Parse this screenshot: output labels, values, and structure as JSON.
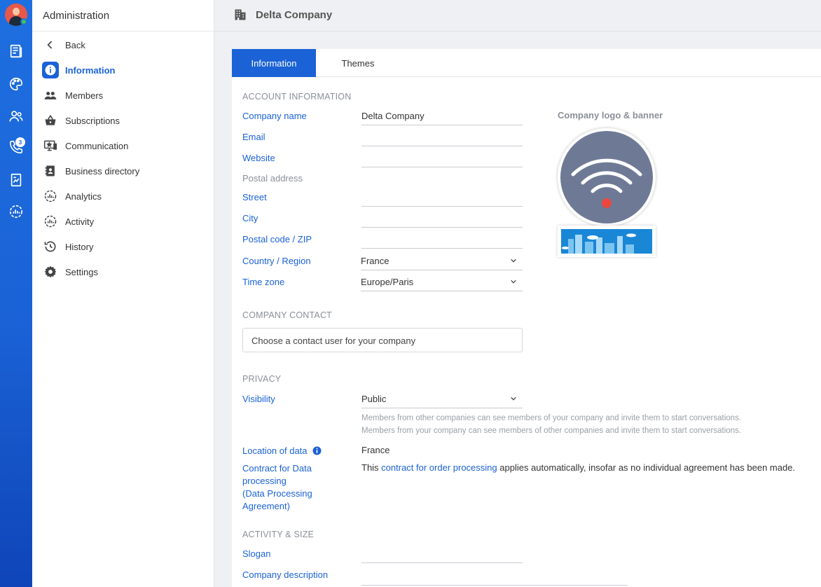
{
  "rail": {
    "badge_count": "3",
    "items": [
      "news-icon",
      "palette-icon",
      "contacts-icon",
      "phone-icon",
      "document-icon",
      "analytics-icon"
    ]
  },
  "sidebar": {
    "title": "Administration",
    "items": [
      {
        "label": "Back",
        "icon": "chevron-left-icon"
      },
      {
        "label": "Information",
        "icon": "info-icon",
        "active": true
      },
      {
        "label": "Members",
        "icon": "members-icon"
      },
      {
        "label": "Subscriptions",
        "icon": "basket-icon"
      },
      {
        "label": "Communication",
        "icon": "monitor-star-icon"
      },
      {
        "label": "Business directory",
        "icon": "address-book-icon"
      },
      {
        "label": "Analytics",
        "icon": "analytics-icon"
      },
      {
        "label": "Activity",
        "icon": "activity-icon"
      },
      {
        "label": "History",
        "icon": "history-icon"
      },
      {
        "label": "Settings",
        "icon": "gear-icon"
      }
    ]
  },
  "header": {
    "title": "Delta Company",
    "icon": "building-icon"
  },
  "tabs": [
    {
      "label": "Information",
      "active": true
    },
    {
      "label": "Themes",
      "active": false
    }
  ],
  "account": {
    "section": "ACCOUNT INFORMATION",
    "company_name_label": "Company name",
    "company_name_value": "Delta Company",
    "email_label": "Email",
    "email_value": "",
    "website_label": "Website",
    "website_value": "",
    "postal_address_label": "Postal address",
    "street_label": "Street",
    "street_value": "",
    "city_label": "City",
    "city_value": "",
    "zip_label": "Postal code / ZIP",
    "zip_value": "",
    "country_label": "Country / Region",
    "country_value": "France",
    "timezone_label": "Time zone",
    "timezone_value": "Europe/Paris"
  },
  "logo": {
    "title": "Company logo & banner"
  },
  "contact": {
    "section": "COMPANY CONTACT",
    "placeholder": "Choose a contact user for your company"
  },
  "privacy": {
    "section": "PRIVACY",
    "visibility_label": "Visibility",
    "visibility_value": "Public",
    "hint1": "Members from other companies can see members of your company and invite them to start conversations.",
    "hint2": "Members from your company can see members of other companies and invite them to start conversations.",
    "location_label": "Location of data",
    "location_value": "France",
    "contract_label_1": "Contract for Data",
    "contract_label_2": "processing",
    "contract_label_3": "(Data Processing",
    "contract_label_4": "Agreement)",
    "contract_text_pre": "This ",
    "contract_link": "contract for order processing",
    "contract_text_post": " applies automatically, insofar as no individual agreement has been made."
  },
  "activity": {
    "section": "ACTIVITY & SIZE",
    "slogan_label": "Slogan",
    "slogan_value": "",
    "description_label": "Company description"
  },
  "colors": {
    "accent": "#1a62d6",
    "rail": "#1e6fe0"
  }
}
